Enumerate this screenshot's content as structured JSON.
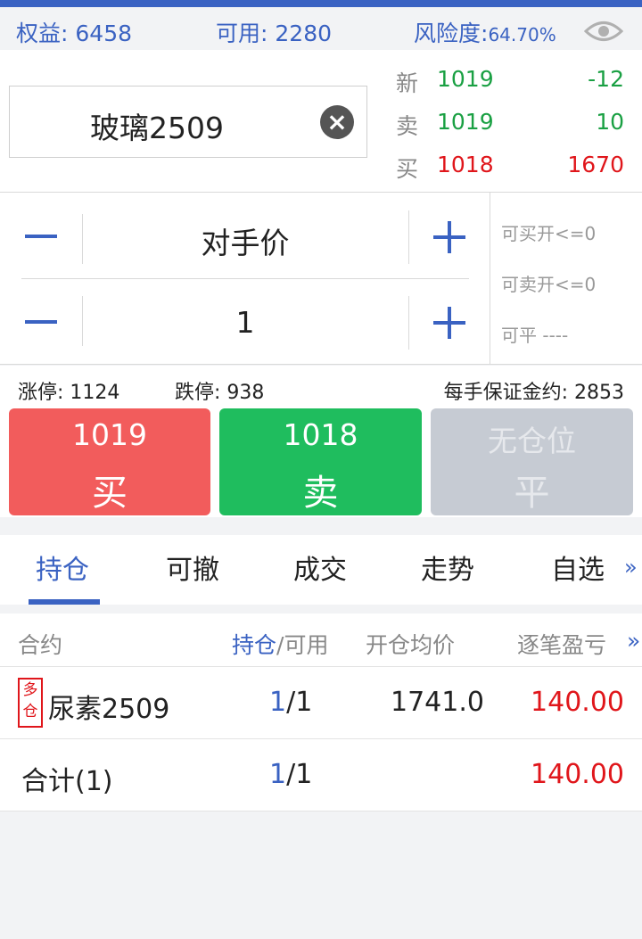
{
  "account": {
    "equity_label": "权益:",
    "equity_value": "6458",
    "available_label": "可用:",
    "available_value": "2280",
    "risk_label": "风险度:",
    "risk_value": "64.70%"
  },
  "quote": {
    "symbol": "玻璃2509",
    "rows": [
      {
        "label": "新",
        "price": "1019",
        "change": "-12"
      },
      {
        "label": "卖",
        "price": "1019",
        "change": "10"
      },
      {
        "label": "买",
        "price": "1018",
        "change": "1670"
      }
    ]
  },
  "order": {
    "price_type": "对手价",
    "quantity": "1",
    "can_buy_open": "可买开<=0",
    "can_sell_open": "可卖开<=0",
    "can_close": "可平 ----"
  },
  "limits": {
    "limit_up": "涨停: 1124",
    "limit_down": "跌停: 938",
    "margin": "每手保证金约: 2853"
  },
  "buttons": {
    "buy_price": "1019",
    "buy_label": "买",
    "sell_price": "1018",
    "sell_label": "卖",
    "close_price": "无仓位",
    "close_label": "平"
  },
  "tabs": [
    "持仓",
    "可撤",
    "成交",
    "走势",
    "自选"
  ],
  "more_glyph": "»",
  "table": {
    "headers": {
      "contract": "合约",
      "pos": "持仓",
      "pos_sep": "/可用",
      "avg": "开仓均价",
      "pnl": "逐笔盈亏"
    },
    "rows": [
      {
        "tag": "多仓",
        "name": "尿素2509",
        "pos": "1",
        "avail": "/1",
        "avg": "1741.0",
        "pnl": "140.00"
      }
    ],
    "total": {
      "name": "合计(1)",
      "pos": "1",
      "avail": "/1",
      "pnl": "140.00"
    }
  },
  "colors": {
    "accent": "#3a62c2",
    "up": "#e0161b",
    "down": "#1aa043",
    "buy": "#f25c5c",
    "sell": "#1fbd5e"
  }
}
